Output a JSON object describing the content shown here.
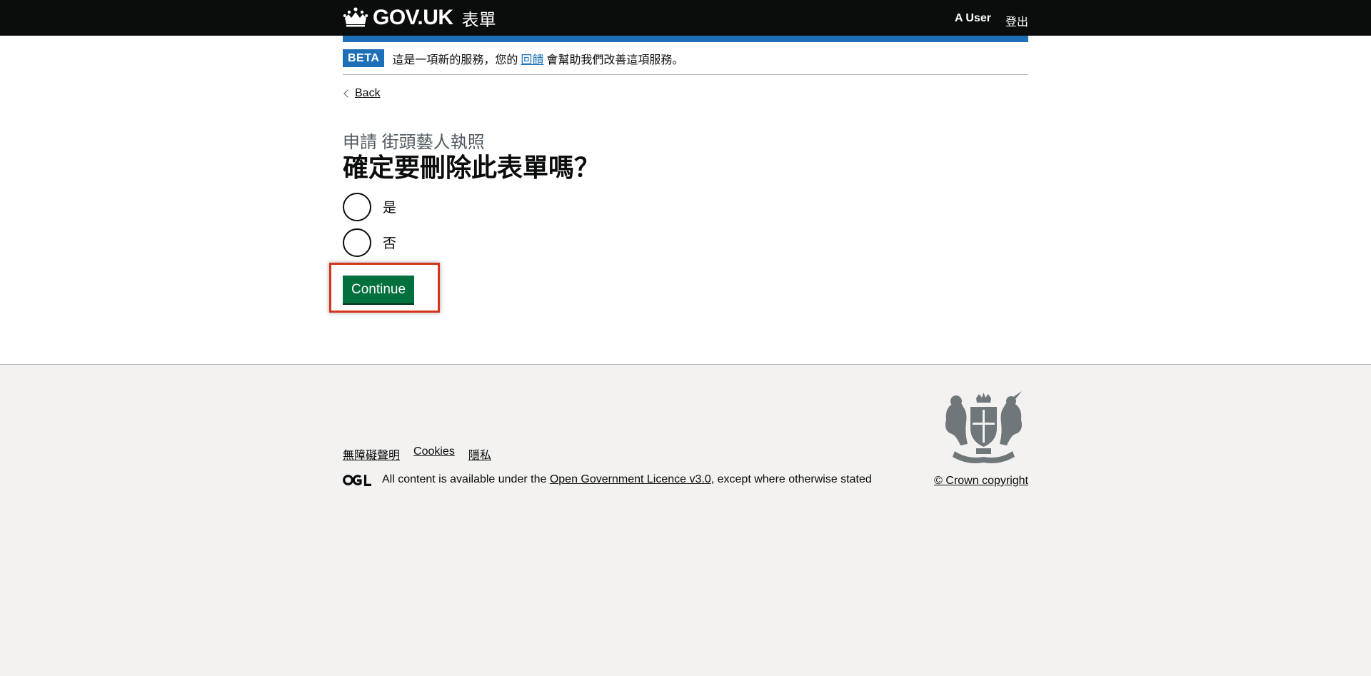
{
  "header": {
    "logotype": "GOV.UK",
    "service_name": "表單",
    "user_label": "A User",
    "signout_label": "登出"
  },
  "phase_banner": {
    "tag": "BETA",
    "text_before": "這是一項新的服務，您的",
    "link": "回饋",
    "text_after": "會幫助我們改善這項服務。"
  },
  "back_link": "Back",
  "main": {
    "caption": "申請 街頭藝人執照",
    "heading": "確定要刪除此表單嗎？",
    "options": [
      {
        "label": "是"
      },
      {
        "label": "否"
      }
    ],
    "continue_label": "Continue"
  },
  "footer": {
    "links": [
      "無障礙聲明",
      "Cookies",
      "隱私"
    ],
    "licence_before": "All content is available under the",
    "licence_link": "Open Government Licence v3.0",
    "licence_after": ", except where otherwise stated",
    "copyright": "© Crown copyright"
  },
  "colors": {
    "header_bg": "#0b0c0c",
    "brand_blue": "#1d70b8",
    "button_green": "#00703c",
    "highlight_red": "#d4351c",
    "footer_bg": "#f3f2f1"
  }
}
